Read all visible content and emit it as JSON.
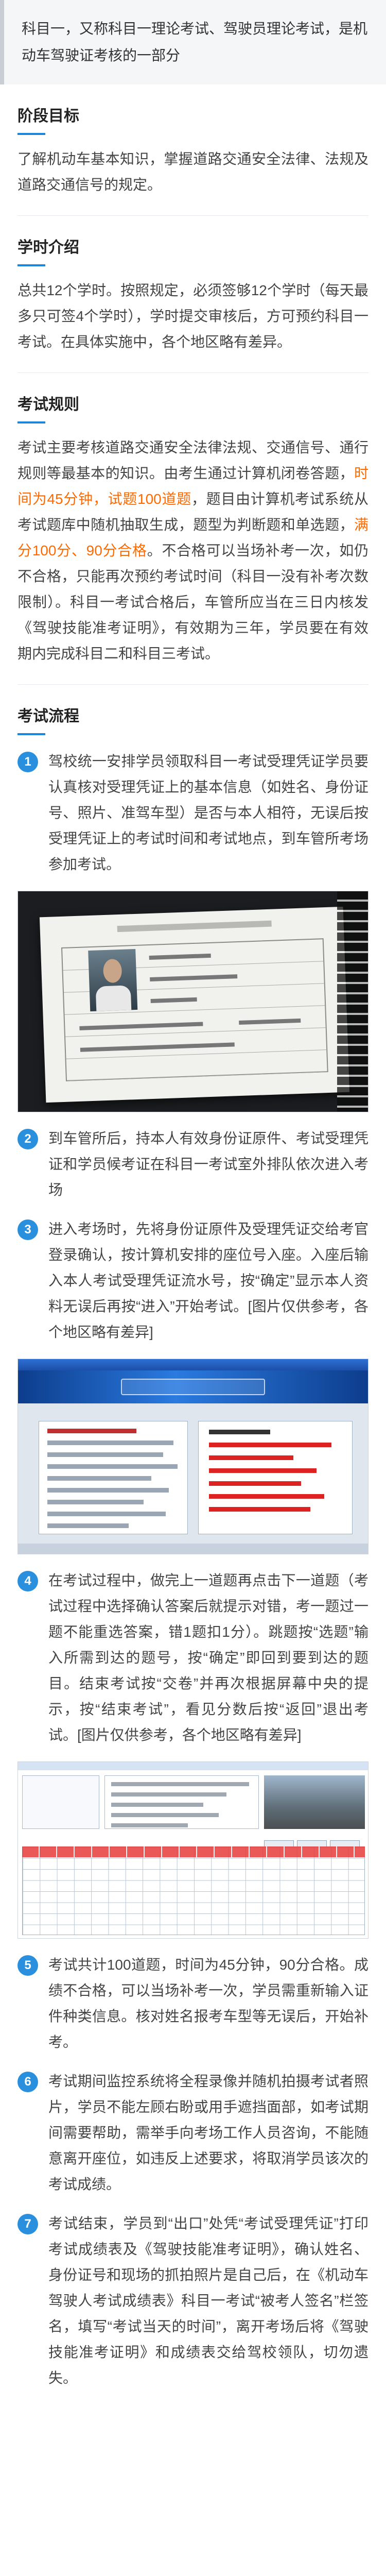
{
  "intro": "科目一，又称科目一理论考试、驾驶员理论考试，是机动车驾驶证考核的一部分",
  "sections": {
    "goal": {
      "title": "阶段目标",
      "text": "了解机动车基本知识，掌握道路交通安全法律、法规及道路交通信号的规定。"
    },
    "intro_hours": {
      "title": "学时介绍",
      "text": "总共12个学时。按照规定，必须签够12个学时（每天最多只可签4个学时），学时提交审核后，方可预约科目一考试。在具体实施中，各个地区略有差异。"
    },
    "rules": {
      "title": "考试规则",
      "p1": "考试主要考核道路交通安全法律法规、交通信号、通行规则等最基本的知识。由考生通过计算机闭卷答题，",
      "hl1": "时间为45分钟，试题100道题",
      "p2": "，题目由计算机考试系统从考试题库中随机抽取生成，题型为判断题和单选题，",
      "hl2": "满分100分、90分合格",
      "p3": "。不合格可以当场补考一次，如仍不合格，只能再次预约考试时间（科目一没有补考次数限制）。科目一考试合格后，车管所应当在三日内核发《驾驶技能准考证明》，有效期为三年，学员要在有效期内完成科目二和科目三考试。"
    },
    "flow": {
      "title": "考试流程",
      "steps": [
        {
          "num": "1",
          "text": "驾校统一安排学员领取科目一考试受理凭证学员要认真核对受理凭证上的基本信息（如姓名、身份证号、照片、准驾车型）是否与本人相符，无误后按受理凭证上的考试时间和考试地点，到车管所考场参加考试。"
        },
        {
          "num": "2",
          "text": "到车管所后，持本人有效身份证原件、考试受理凭证和学员候考证在科目一考试室外排队依次进入考场"
        },
        {
          "num": "3",
          "text": "进入考场时，先将身份证原件及受理凭证交给考官登录确认，按计算机安排的座位号入座。入座后输入本人考试受理凭证流水号，按“确定”显示本人资料无误后再按“进入”开始考试。[图片仅供参考，各个地区略有差异]"
        },
        {
          "num": "4",
          "text": "在考试过程中，做完上一道题再点击下一道题（考试过程中选择确认答案后就提示对错，考一题过一题不能重选答案，错1题扣1分）。跳题按“选题”输入所需到达的题号，按“确定”即回到要到达的题目。结束考试按“交卷”并再次根据屏幕中央的提示，按“结束考试”，看见分数后按“返回”退出考试。[图片仅供参考，各个地区略有差异]"
        },
        {
          "num": "5",
          "text": "考试共计100道题，时间为45分钟，90分合格。成绩不合格，可以当场补考一次，学员需重新输入证件种类信息。核对姓名报考车型等无误后，开始补考。"
        },
        {
          "num": "6",
          "text": "考试期间监控系统将全程录像并随机拍摄考试者照片，学员不能左顾右盼或用手遮挡面部，如考试期间需要帮助，需举手向考场工作人员咨询，不能随意离开座位，如违反上述要求，将取消学员该次的考试成绩。"
        },
        {
          "num": "7",
          "text": "考试结束，学员到“出口”处凭“考试受理凭证”打印考试成绩表及《驾驶技能准考证明》，确认姓名、身份证号和现场的抓拍照片是自己后，在《机动车驾驶人考试成绩表》科目一考试“被考人签名”栏签名，填写“考试当天的时间”，离开考场后将《驾驶技能准考证明》和成绩表交给驾校领队，切勿遗失。"
        }
      ]
    }
  }
}
